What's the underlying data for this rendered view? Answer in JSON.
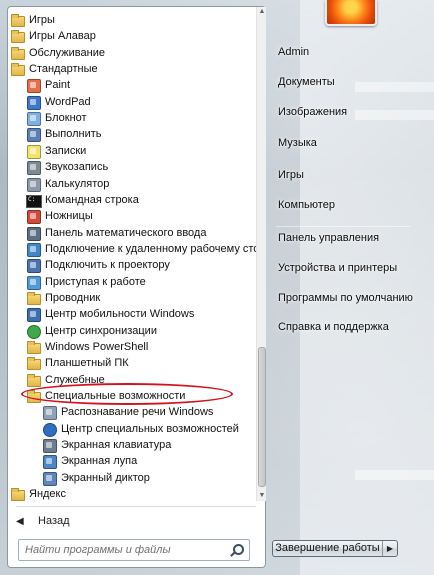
{
  "programs": [
    {
      "label": "Игры",
      "icon": "folder-icon",
      "kind": "folder"
    },
    {
      "label": "Игры Алавар",
      "icon": "folder-icon",
      "kind": "folder"
    },
    {
      "label": "Обслуживание",
      "icon": "folder-icon",
      "kind": "folder"
    },
    {
      "label": "Стандартные",
      "icon": "folder-icon",
      "kind": "folder"
    },
    {
      "label": "Paint",
      "icon": "paint-icon",
      "kind": "app",
      "color": "#e2704a"
    },
    {
      "label": "WordPad",
      "icon": "wordpad-icon",
      "kind": "app",
      "color": "#3c78c9"
    },
    {
      "label": "Блокнот",
      "icon": "notepad-icon",
      "kind": "app",
      "color": "#7fb0e0"
    },
    {
      "label": "Выполнить",
      "icon": "run-icon",
      "kind": "app",
      "color": "#5a7fb4"
    },
    {
      "label": "Записки",
      "icon": "sticky-notes-icon",
      "kind": "app",
      "color": "#f3e36a"
    },
    {
      "label": "Звукозапись",
      "icon": "microphone-icon",
      "kind": "app",
      "color": "#7d8a96"
    },
    {
      "label": "Калькулятор",
      "icon": "calculator-icon",
      "kind": "app",
      "color": "#8d9aa6"
    },
    {
      "label": "Командная строка",
      "icon": "command-prompt-icon",
      "kind": "cmd"
    },
    {
      "label": "Ножницы",
      "icon": "scissors-icon",
      "kind": "app",
      "color": "#d24a3a"
    },
    {
      "label": "Панель математического ввода",
      "icon": "math-input-icon",
      "kind": "app",
      "color": "#5d6f82"
    },
    {
      "label": "Подключение к удаленному рабочему столу",
      "icon": "remote-desktop-icon",
      "kind": "app",
      "color": "#3f87c7"
    },
    {
      "label": "Подключить к проектору",
      "icon": "projector-icon",
      "kind": "app",
      "color": "#4a74b0"
    },
    {
      "label": "Приступая к работе",
      "icon": "getting-started-icon",
      "kind": "app",
      "color": "#4f9ad8"
    },
    {
      "label": "Проводник",
      "icon": "explorer-icon",
      "kind": "folder"
    },
    {
      "label": "Центр мобильности Windows",
      "icon": "mobility-center-icon",
      "kind": "app",
      "color": "#3b6fb1"
    },
    {
      "label": "Центр синхронизации",
      "icon": "sync-center-icon",
      "kind": "round",
      "color": "#3ea84a"
    },
    {
      "label": "Windows PowerShell",
      "icon": "folder-icon",
      "kind": "folder"
    },
    {
      "label": "Планшетный ПК",
      "icon": "folder-icon",
      "kind": "folder"
    },
    {
      "label": "Служебные",
      "icon": "folder-icon",
      "kind": "folder"
    },
    {
      "label": "Специальные возможности",
      "icon": "folder-icon",
      "kind": "folder"
    },
    {
      "label": "Распознавание речи Windows",
      "icon": "speech-recognition-icon",
      "kind": "app",
      "color": "#8fa2b6"
    },
    {
      "label": "Центр специальных возможностей",
      "icon": "ease-of-access-icon",
      "kind": "round",
      "color": "#2f6fc0"
    },
    {
      "label": "Экранная клавиатура",
      "icon": "keyboard-icon",
      "kind": "app",
      "color": "#6c7d8f"
    },
    {
      "label": "Экранная лупа",
      "icon": "magnifier-icon",
      "kind": "app",
      "color": "#4b86c6"
    },
    {
      "label": "Экранный диктор",
      "icon": "narrator-icon",
      "kind": "app",
      "color": "#5f86b8"
    },
    {
      "label": "Яндекс",
      "icon": "folder-icon",
      "kind": "folder"
    }
  ],
  "back_label": "Назад",
  "search_placeholder": "Найти программы и файлы",
  "right_links": [
    "Admin",
    "Документы",
    "Изображения",
    "Музыка",
    "Игры",
    "Компьютер",
    "Панель управления",
    "Устройства и принтеры",
    "Программы по умолчанию",
    "Справка и поддержка"
  ],
  "shutdown_label": "Завершение работы",
  "highlight_color": "#d4121e"
}
